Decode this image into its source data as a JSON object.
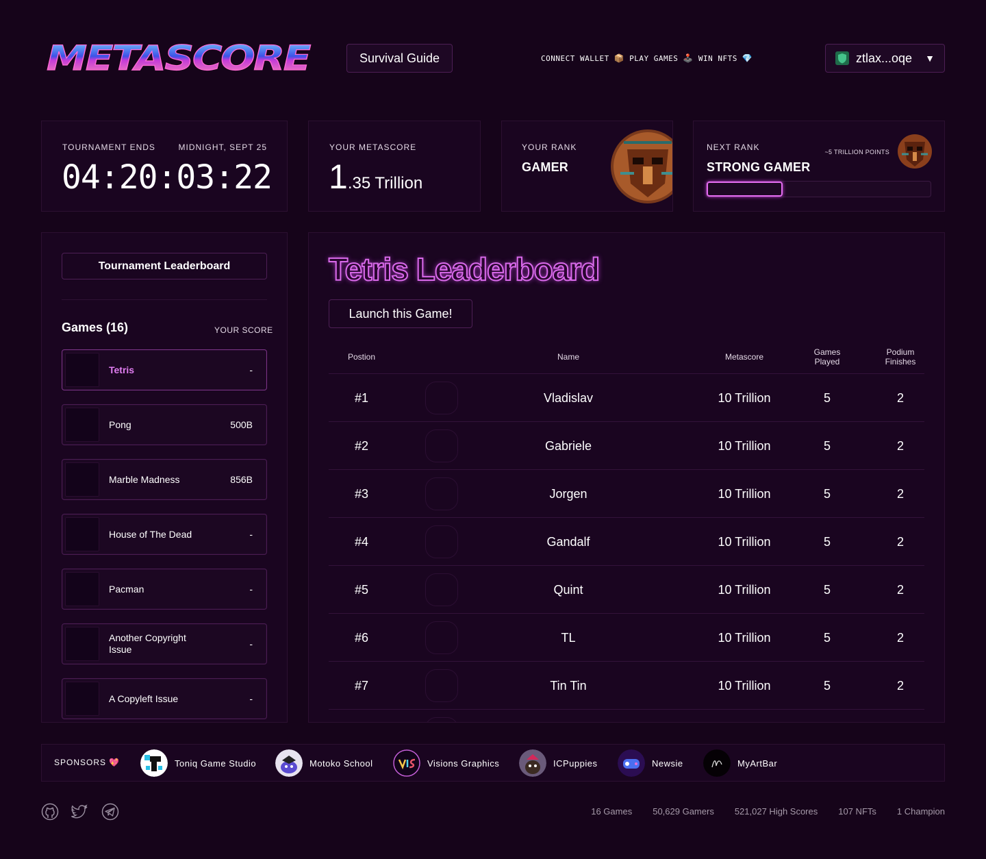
{
  "header": {
    "logo_text": "METASCORE",
    "survival_label": "Survival Guide",
    "tagline": [
      {
        "text": "CONNECT WALLET",
        "emoji": "📦"
      },
      {
        "text": "PLAY GAMES",
        "emoji": "🕹️"
      },
      {
        "text": "WIN NFTS",
        "emoji": "💎"
      }
    ],
    "wallet_label": "ztlax...oqe",
    "wallet_caret": "▼"
  },
  "stats_cards": {
    "tournament": {
      "label": "TOURNAMENT ENDS",
      "date": "MIDNIGHT, SEPT 25",
      "countdown": "04:20:03:22"
    },
    "metascore": {
      "label": "YOUR METASCORE",
      "big": "1",
      "rest": ".35 Trillion"
    },
    "rank": {
      "label": "YOUR RANK",
      "name": "GAMER"
    },
    "next_rank": {
      "label": "NEXT RANK",
      "points": "~5 TRILLION POINTS",
      "name": "STRONG GAMER",
      "progress": 0.34
    }
  },
  "sidebar": {
    "leaderboard_button": "Tournament Leaderboard",
    "games_title": "Games (16)",
    "score_header": "YOUR SCORE",
    "games": [
      {
        "name": "Tetris",
        "score": "-",
        "active": true
      },
      {
        "name": "Pong",
        "score": "500B",
        "active": false
      },
      {
        "name": "Marble Madness",
        "score": "856B",
        "active": false
      },
      {
        "name": "House of The Dead",
        "score": "-",
        "active": false
      },
      {
        "name": "Pacman",
        "score": "-",
        "active": false
      },
      {
        "name": "Another Copyright Issue",
        "score": "-",
        "active": false
      },
      {
        "name": "A Copyleft Issue",
        "score": "-",
        "active": false
      }
    ]
  },
  "leaderboard": {
    "title": "Tetris Leaderboard",
    "launch_label": "Launch this Game!",
    "columns": {
      "position": "Postion",
      "name": "Name",
      "metascore": "Metascore",
      "games_played": "Games Played",
      "podium": "Podium Finishes"
    },
    "rows": [
      {
        "position": "#1",
        "name": "Vladislav",
        "metascore": "10 Trillion",
        "played": "5",
        "podium": "2"
      },
      {
        "position": "#2",
        "name": "Gabriele",
        "metascore": "10 Trillion",
        "played": "5",
        "podium": "2"
      },
      {
        "position": "#3",
        "name": "Jorgen",
        "metascore": "10 Trillion",
        "played": "5",
        "podium": "2"
      },
      {
        "position": "#4",
        "name": "Gandalf",
        "metascore": "10 Trillion",
        "played": "5",
        "podium": "2"
      },
      {
        "position": "#5",
        "name": "Quint",
        "metascore": "10 Trillion",
        "played": "5",
        "podium": "2"
      },
      {
        "position": "#6",
        "name": "TL",
        "metascore": "10 Trillion",
        "played": "5",
        "podium": "2"
      },
      {
        "position": "#7",
        "name": "Tin Tin",
        "metascore": "10 Trillion",
        "played": "5",
        "podium": "2"
      }
    ]
  },
  "sponsors": {
    "label": "SPONSORS 💖",
    "items": [
      {
        "name": "Toniq Game Studio",
        "icon": "toniq-logo"
      },
      {
        "name": "Motoko School",
        "icon": "motoko-logo"
      },
      {
        "name": "Visions Graphics",
        "icon": "visions-logo"
      },
      {
        "name": "ICPuppies",
        "icon": "icpuppies-logo"
      },
      {
        "name": "Newsie",
        "icon": "newsie-logo"
      },
      {
        "name": "MyArtBar",
        "icon": "myartbar-logo"
      }
    ]
  },
  "footer": {
    "social": [
      "github-icon",
      "twitter-icon",
      "telegram-icon"
    ],
    "stats": [
      "16 Games",
      "50,629 Gamers",
      "521,027 High Scores",
      "107 NFTs",
      "1 Champion"
    ]
  },
  "colors": {
    "background": "#16041a",
    "panel": "#1a0520",
    "accent": "#e46df0",
    "border": "#4d1f55"
  }
}
